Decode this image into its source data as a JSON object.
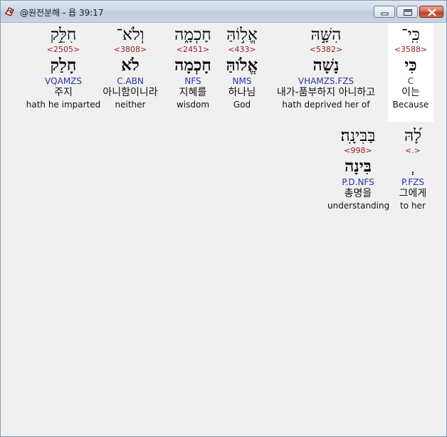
{
  "window": {
    "title": "@원전분해 - 욥 39:17",
    "icon": "app-swirl-icon"
  },
  "verse_words": [
    {
      "hebrew": "חִלֵּ֣ק",
      "strong": "<2505>",
      "lemma": "חָלַק",
      "morph": "VQAMZS",
      "korean": "주지",
      "english": "hath he imparted",
      "highlight": false
    },
    {
      "hebrew": "וְלֹא־",
      "strong": "<3808>",
      "lemma": "לֹא",
      "morph": "C.ABN",
      "korean": "아니함이니라",
      "english": "neither",
      "highlight": false
    },
    {
      "hebrew": "חָכְמָ֑ה",
      "strong": "<2451>",
      "lemma": "חָכְמָה",
      "morph": "NFS",
      "korean": "지혜를",
      "english": "wisdom",
      "highlight": false
    },
    {
      "hebrew": "אֱל֣וֹהַּ",
      "strong": "<433>",
      "lemma": "אֱלֹוהַּ",
      "morph": "NMS",
      "korean": "하나님",
      "english": "God",
      "highlight": false
    },
    {
      "hebrew": "הִשָּׁ֣הּ",
      "strong": "<5382>",
      "lemma": "נָשָׁה",
      "morph": "VHAMZS.FZS",
      "korean": "내가-품부하지 아니하고",
      "english": "hath deprived her of",
      "highlight": false
    },
    {
      "hebrew": "כִּֽי־",
      "strong": "<3588>",
      "lemma": "כִּי",
      "morph": "C",
      "korean": "이는",
      "english": "Because",
      "highlight": true
    },
    {
      "hebrew": "בַּבִּינָֽה׃",
      "strong": "<998>",
      "lemma": "בִּינָה",
      "morph": "P.D.NFS",
      "korean": "총명을",
      "english": "understanding",
      "highlight": false
    },
    {
      "hebrew": "לָ֝הּ",
      "strong": "<.>",
      "lemma": "ְ",
      "morph": "P.FZS",
      "korean": "그에게",
      "english": "to her",
      "highlight": false
    }
  ]
}
